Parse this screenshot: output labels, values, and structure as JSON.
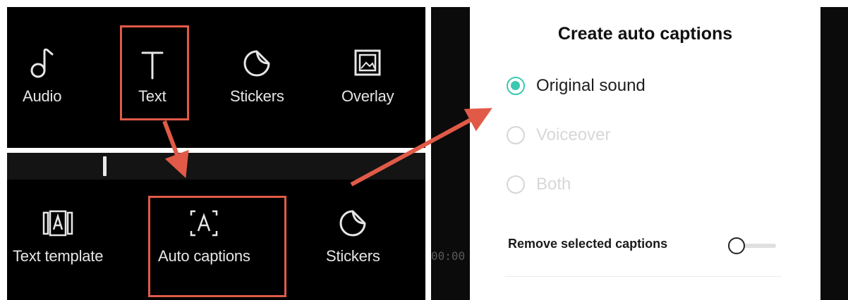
{
  "top_toolbar": {
    "items": [
      {
        "label": "Audio",
        "icon": "music-note-icon"
      },
      {
        "label": "Text",
        "icon": "text-icon"
      },
      {
        "label": "Stickers",
        "icon": "sticker-icon"
      },
      {
        "label": "Overlay",
        "icon": "overlay-icon"
      }
    ]
  },
  "text_toolbar": {
    "items": [
      {
        "label": "Text template",
        "icon": "text-template-icon"
      },
      {
        "label": "Auto captions",
        "icon": "auto-captions-icon"
      },
      {
        "label": "Stickers",
        "icon": "sticker-icon"
      }
    ]
  },
  "timecode": "00:00",
  "dialog": {
    "title": "Create auto captions",
    "options": [
      {
        "label": "Original sound",
        "selected": true
      },
      {
        "label": "Voiceover",
        "selected": false
      },
      {
        "label": "Both",
        "selected": false
      }
    ],
    "remove_label": "Remove selected captions",
    "remove_toggle_on": false
  },
  "colors": {
    "highlight": "#e05a47",
    "accent": "#3bc8b1",
    "toolbar_bg": "#000000",
    "toolbar_text": "#e6e6e6"
  }
}
